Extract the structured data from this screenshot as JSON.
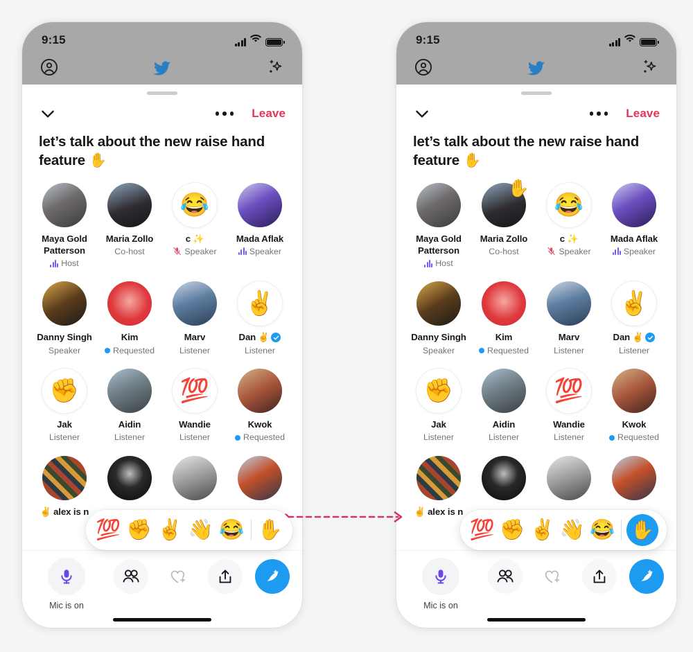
{
  "background_color": "#f4f5f7",
  "accent": {
    "twitter_blue": "#1d9bf0",
    "leave_red": "#e8335a",
    "mic_purple": "#6b45e8",
    "arrow_pink": "#d4336a"
  },
  "status_bar": {
    "time": "9:15",
    "signal_icon": "cellular-bars-icon",
    "wifi_icon": "wifi-icon",
    "battery_icon": "battery-full-icon"
  },
  "twitter_chrome": {
    "profile_icon": "account-circle-icon",
    "logo_icon": "twitter-bird-icon",
    "sparkle_icon": "sparkle-icon"
  },
  "sheet": {
    "collapse_icon": "chevron-down-icon",
    "more_icon": "more-horizontal-icon",
    "leave_label": "Leave",
    "room_title": "let’s talk about the new raise hand feature ✋"
  },
  "participants": [
    {
      "name": "Maya Gold Patterson",
      "role": "Host",
      "role_icon": "audio-wave-icon",
      "avatar": "photo",
      "avatar_kind": "photo",
      "raised_hand": false,
      "verified": false,
      "name_emoji": ""
    },
    {
      "name": "Maria Zollo",
      "role": "Co-host",
      "role_icon": "none",
      "avatar": "photo",
      "avatar_kind": "photo",
      "raised_hand_right_only": true,
      "raised_hand": false,
      "verified": false,
      "name_emoji": ""
    },
    {
      "name": "c",
      "role": "Speaker",
      "role_icon": "mic-muted-icon",
      "avatar": "😂",
      "avatar_kind": "emoji",
      "raised_hand": false,
      "verified": false,
      "name_emoji": "✨"
    },
    {
      "name": "Mada Aflak",
      "role": "Speaker",
      "role_icon": "audio-wave-icon",
      "avatar": "photo",
      "avatar_kind": "photo",
      "raised_hand": false,
      "verified": false,
      "name_emoji": ""
    },
    {
      "name": "Danny Singh",
      "role": "Speaker",
      "role_icon": "none",
      "avatar": "photo",
      "avatar_kind": "photo",
      "raised_hand": false,
      "verified": false,
      "name_emoji": ""
    },
    {
      "name": "Kim",
      "role": "Requested",
      "role_icon": "blue-dot-icon",
      "avatar": "photo",
      "avatar_kind": "photo",
      "raised_hand": false,
      "verified": false,
      "name_emoji": ""
    },
    {
      "name": "Marv",
      "role": "Listener",
      "role_icon": "none",
      "avatar": "photo",
      "avatar_kind": "photo",
      "raised_hand": false,
      "verified": false,
      "name_emoji": ""
    },
    {
      "name": "Dan",
      "role": "Listener",
      "role_icon": "none",
      "avatar": "✌️",
      "avatar_kind": "emoji",
      "raised_hand": false,
      "verified": true,
      "name_emoji": "✌️"
    },
    {
      "name": "Jak",
      "role": "Listener",
      "role_icon": "none",
      "avatar": "✊",
      "avatar_kind": "emoji",
      "raised_hand": false,
      "verified": false,
      "name_emoji": ""
    },
    {
      "name": "Aidin",
      "role": "Listener",
      "role_icon": "none",
      "avatar": "photo",
      "avatar_kind": "photo",
      "raised_hand": false,
      "verified": false,
      "name_emoji": ""
    },
    {
      "name": "Wandie",
      "role": "Listener",
      "role_icon": "none",
      "avatar": "💯",
      "avatar_kind": "emoji",
      "raised_hand": false,
      "verified": false,
      "name_emoji": ""
    },
    {
      "name": "Kwok",
      "role": "Requested",
      "role_icon": "blue-dot-icon",
      "avatar": "photo",
      "avatar_kind": "photo",
      "raised_hand": false,
      "verified": false,
      "name_emoji": ""
    }
  ],
  "partial_row": {
    "name": "alex is n",
    "name_emoji": "✌️"
  },
  "emoji_tray": {
    "emojis": [
      "💯",
      "✊",
      "✌️",
      "👋",
      "😂"
    ],
    "raise_hand_emoji": "✋",
    "raise_hand_selected_left": false,
    "raise_hand_selected_right": true
  },
  "bottom_bar": {
    "mic_icon": "microphone-icon",
    "mic_label": "Mic is on",
    "people_icon": "people-icon",
    "heart_plus_icon": "heart-plus-icon",
    "share_icon": "share-up-icon",
    "compose_icon": "compose-tweet-icon"
  },
  "annotation": {
    "arrow_icon": "dashed-arrow-right-icon",
    "color": "#d4336a"
  }
}
